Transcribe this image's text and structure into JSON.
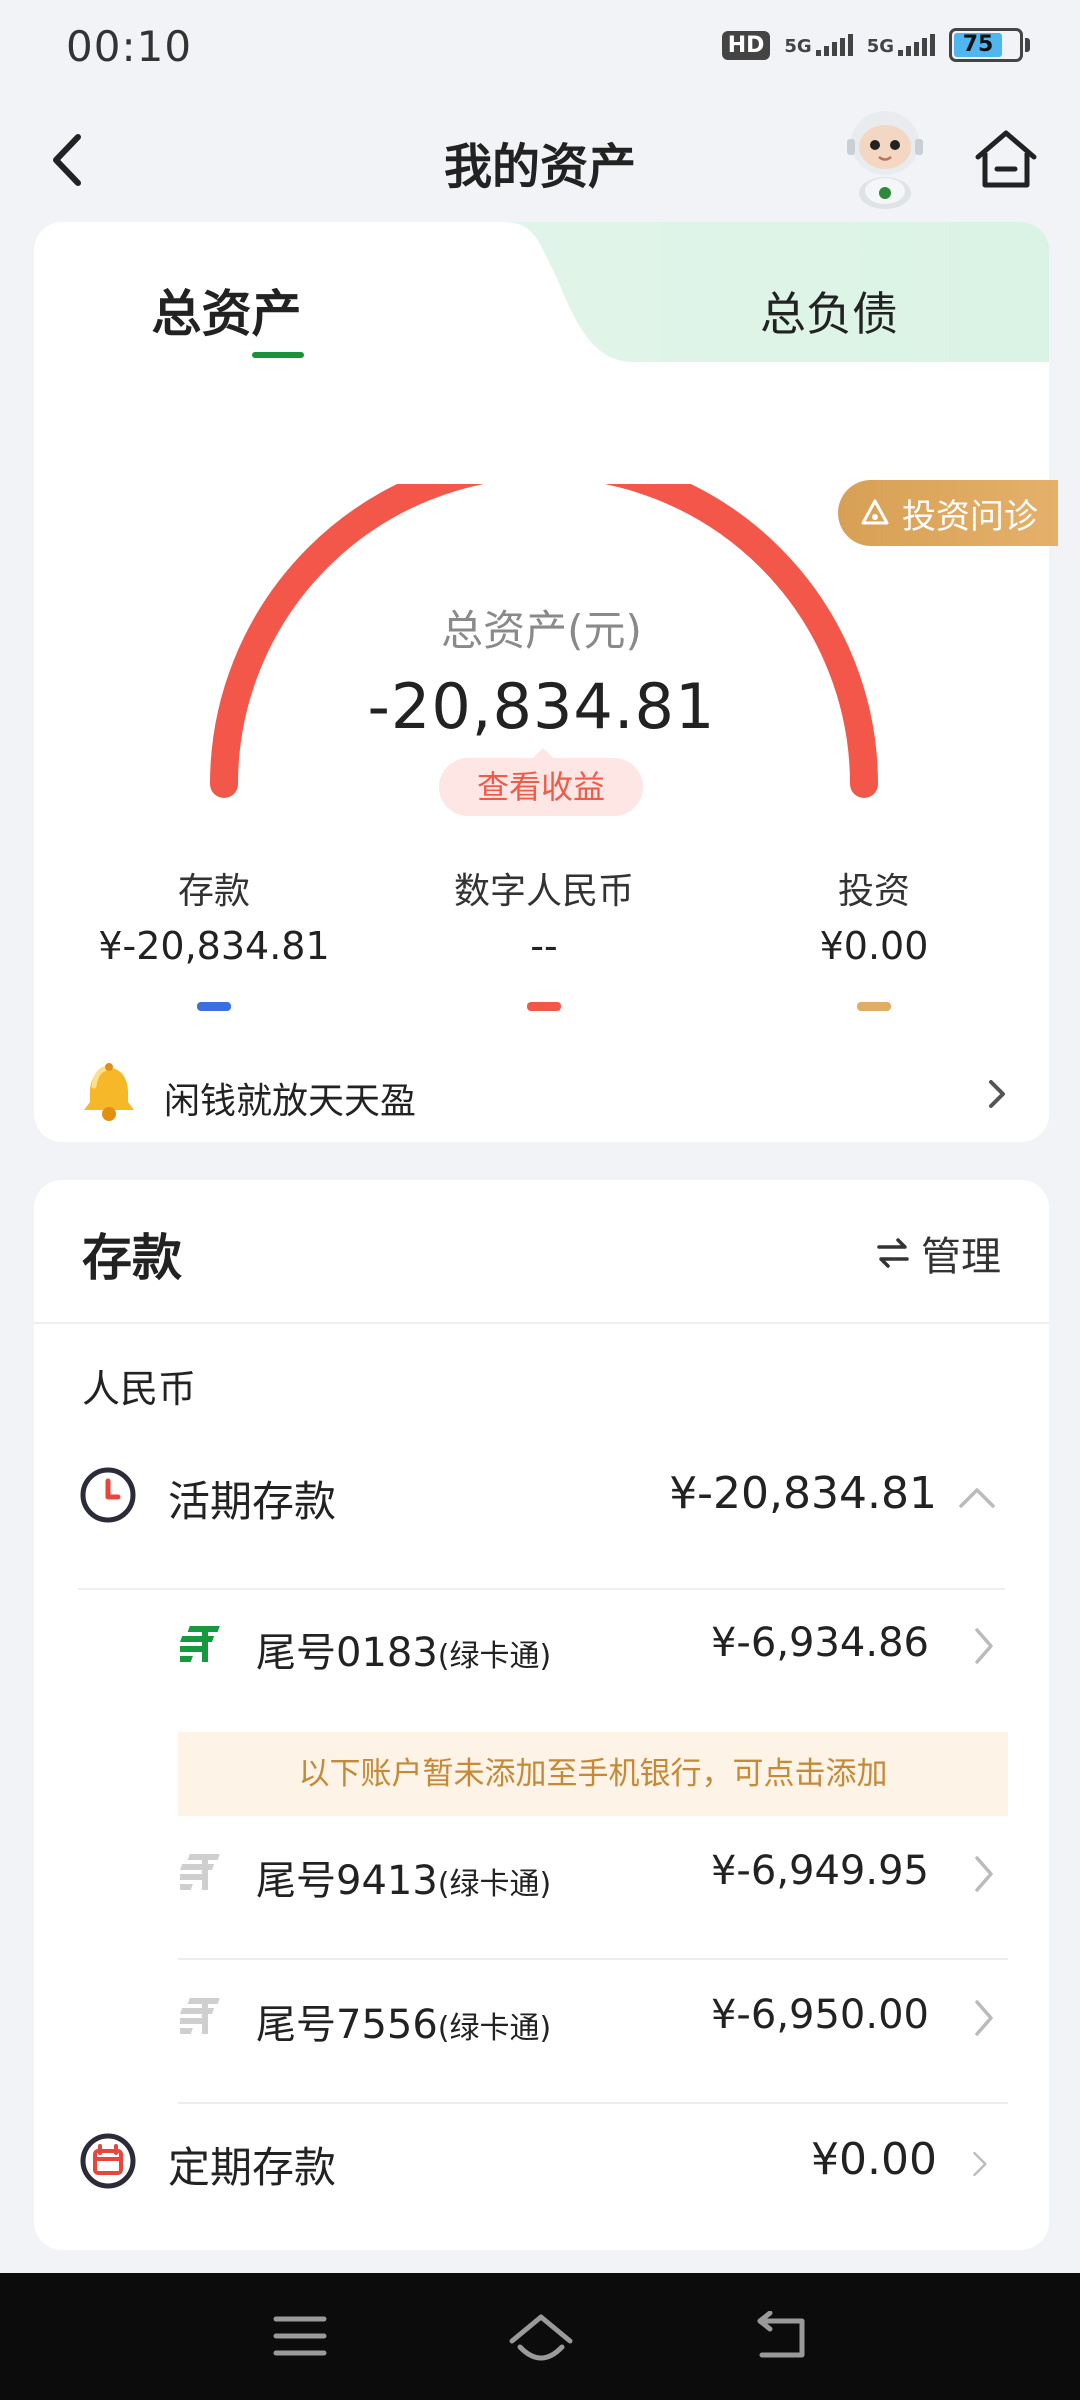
{
  "status_bar": {
    "time": "00:10",
    "hd": "HD",
    "signal1": "5G",
    "signal2": "5G",
    "battery": "75"
  },
  "nav": {
    "title": "我的资产"
  },
  "tabs": {
    "assets": "总资产",
    "liabilities": "总负债"
  },
  "invest_diagnosis": "投资问诊",
  "gauge": {
    "label": "总资产(元)",
    "value": "-20,834.81",
    "view_income": "查看收益"
  },
  "breakdown": [
    {
      "label": "存款",
      "value": "¥-20,834.81",
      "color": "#3b6fe0"
    },
    {
      "label": "数字人民币",
      "value": "--",
      "color": "#f3574a"
    },
    {
      "label": "投资",
      "value": "¥0.00",
      "color": "#e0ad66"
    }
  ],
  "tip": {
    "text": "闲钱就放天天盈"
  },
  "deposits": {
    "title": "存款",
    "manage": "管理",
    "currency": "人民币",
    "demand": {
      "name": "活期存款",
      "amount": "¥-20,834.81"
    },
    "accounts": [
      {
        "name": "尾号0183",
        "type": "(绿卡通)",
        "amount": "¥-6,934.86"
      },
      {
        "name": "尾号9413",
        "type": "(绿卡通)",
        "amount": "¥-6,949.95"
      },
      {
        "name": "尾号7556",
        "type": "(绿卡通)",
        "amount": "¥-6,950.00"
      }
    ],
    "notice": "以下账户暂未添加至手机银行，可点击添加",
    "fixed": {
      "name": "定期存款",
      "amount": "¥0.00"
    }
  },
  "colors": {
    "accent_green": "#14953c",
    "gauge_red": "#f3574a"
  }
}
